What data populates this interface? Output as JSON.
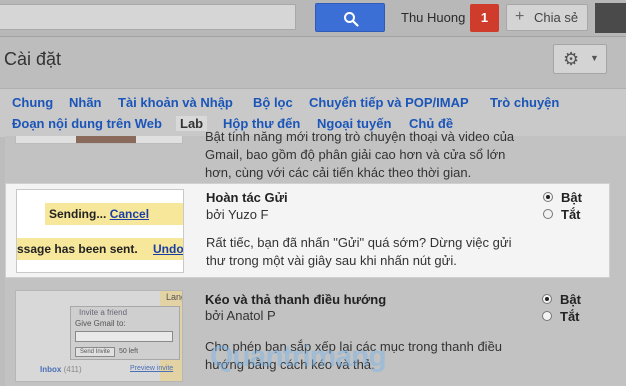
{
  "header": {
    "user_name": "Thu Huong",
    "notification_count": "1",
    "share_label": "Chia sẻ"
  },
  "page": {
    "title": "Cài đặt"
  },
  "tabs": [
    {
      "label": "Chung"
    },
    {
      "label": "Nhãn"
    },
    {
      "label": "Tài khoản và Nhập"
    },
    {
      "label": "Bộ lọc"
    },
    {
      "label": "Chuyển tiếp và POP/IMAP"
    },
    {
      "label": "Trò chuyện"
    },
    {
      "label": "Đoạn nội dung trên Web"
    },
    {
      "label": "Lab",
      "active": true
    },
    {
      "label": "Hộp thư đến"
    },
    {
      "label": "Ngoại tuyến"
    },
    {
      "label": "Chủ đề"
    }
  ],
  "labs": [
    {
      "desc_lines": [
        "Bật tính năng mới trong trò chuyện thoại và video của",
        "Gmail, bao gồm độ phân giải cao hơn và cửa sổ lớn",
        "hơn, cùng với các cải tiến khác theo thời gian."
      ]
    },
    {
      "title": "Hoàn tác Gửi",
      "author": "bởi Yuzo F",
      "desc_lines": [
        "Rất tiếc, bạn đã nhấn \"Gửi\" quá sớm? Dừng việc gửi",
        "thư trong một vài giây sau khi nhấn nút gửi."
      ],
      "enable_label": "Bật",
      "disable_label": "Tắt",
      "selected": "Bật",
      "preview": {
        "sending_text": "Sending...",
        "cancel_text": "Cancel",
        "sent_text": "ssage has been sent.",
        "undo_text": "Undo"
      }
    },
    {
      "title": "Kéo và thả thanh điều hướng",
      "author": "bởi Anatol P",
      "desc_lines": [
        "Cho phép bạn sắp xếp lại các mục trong thanh điều",
        "hướng bằng cách kéo và thả."
      ],
      "enable_label": "Bật",
      "disable_label": "Tắt",
      "selected": "Bật",
      "preview": {
        "side_label": "Langu",
        "invite_text": "Invite a friend",
        "give_text": "Give Gmail to:",
        "send_text": "Send Invite",
        "left_text": "50 left",
        "inbox_text": "Inbox",
        "inbox_count": "(411)",
        "preview_text": "Preview invite"
      }
    }
  ],
  "watermark": "Quantrimang"
}
